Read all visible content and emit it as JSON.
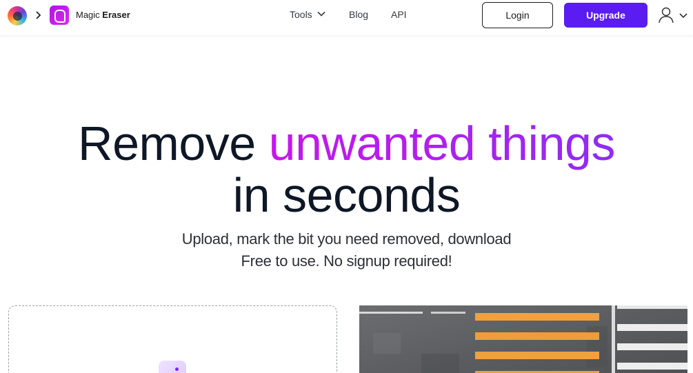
{
  "header": {
    "brand_icon": "picsart-logo-icon",
    "crumb_icon": "chevron-right-icon",
    "product": {
      "icon": "magic-eraser-logo-icon",
      "name_regular": "Magic ",
      "name_bold": "Eraser"
    },
    "nav": {
      "tools_label": "Tools",
      "tools_icon": "chevron-down-icon",
      "blog_label": "Blog",
      "api_label": "API"
    },
    "login_label": "Login",
    "upgrade_label": "Upgrade",
    "user_icon": "user-icon",
    "user_menu_icon": "chevron-down-icon"
  },
  "hero": {
    "title_part1": "Remove ",
    "title_highlight": "unwanted things",
    "title_line2": "in seconds",
    "subtitle_line1": "Upload, mark the bit you need removed, download",
    "subtitle_line2": "Free to use. No signup required!"
  },
  "upload": {
    "icon": "upload-image-icon"
  },
  "example": {
    "image": "aerial-crosswalk-photo"
  },
  "colors": {
    "accent": "#5a1cf0",
    "highlight_start": "#c617ea",
    "highlight_end": "#8c2ef2",
    "text": "#0e1726",
    "crosswalk_orange": "#f0a040"
  }
}
